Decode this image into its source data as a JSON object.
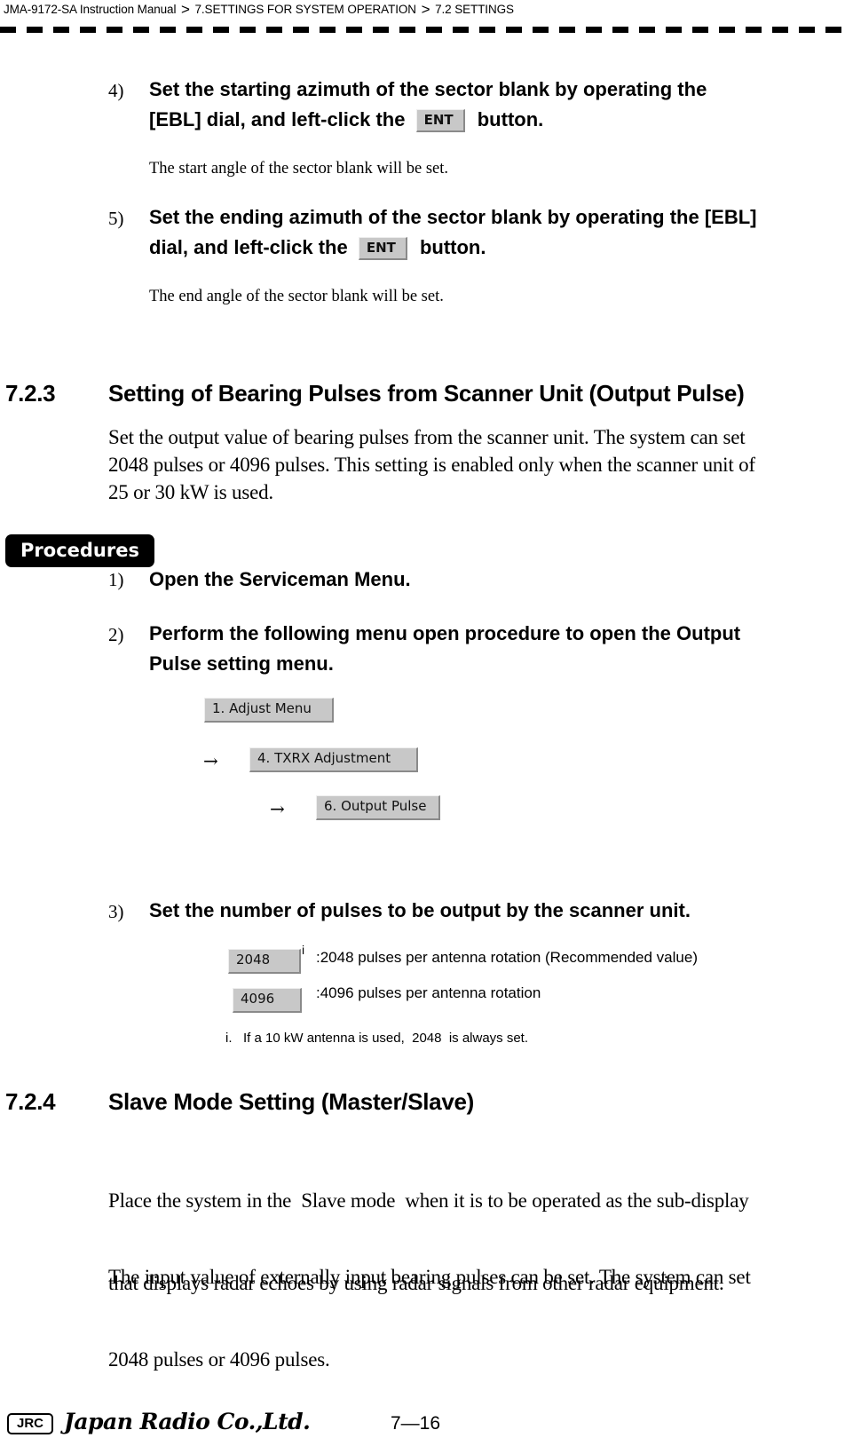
{
  "header": {
    "breadcrumb": [
      "JMA-9172-SA Instruction Manual",
      "7.SETTINGS FOR SYSTEM OPERATION",
      "7.2  SETTINGS"
    ],
    "separator": ">"
  },
  "section_722_tail": {
    "steps": [
      {
        "num": "4)",
        "line1": "Set the starting azimuth of the sector blank by operating the",
        "line2_pre": "[EBL] dial, and left-click the",
        "button": "ENT",
        "line2_post": "button.",
        "note": "The start angle of the sector blank will be set."
      },
      {
        "num": "5)",
        "line1": "Set the ending azimuth of the sector blank by operating the [EBL]",
        "line2_pre": "dial, and left-click the",
        "button": "ENT",
        "line2_post": "button.",
        "note": "The end angle of the sector blank will be set."
      }
    ]
  },
  "section_723": {
    "number": "7.2.3",
    "title": "Setting of Bearing Pulses from Scanner Unit (Output Pulse)",
    "body": [
      "Set the output value of bearing pulses from the scanner unit. The system can set",
      "2048 pulses or 4096 pulses. This setting is enabled only when the scanner unit of",
      "25 or 30 kW is used."
    ],
    "procedures_label": "Procedures",
    "steps": [
      {
        "num": "1)",
        "text": "Open the Serviceman Menu."
      },
      {
        "num": "2)",
        "line1": "Perform the following menu open procedure to open the Output",
        "line2": "Pulse setting menu."
      },
      {
        "num": "3)",
        "text": "Set the number of pulses to be output by the scanner unit."
      }
    ],
    "menu_path": {
      "arrow": "→",
      "items": [
        "1. Adjust Menu",
        "4. TXRX Adjustment",
        "6. Output Pulse"
      ]
    },
    "options": [
      {
        "button": "2048",
        "footnote_mark": "i",
        "description": ":2048 pulses per antenna rotation (Recommended value)"
      },
      {
        "button": "4096",
        "description": ":4096 pulses per antenna rotation"
      }
    ],
    "footnote": "i.   If a 10 kW antenna is used,  2048  is always set."
  },
  "section_724": {
    "number": "7.2.4",
    "title": "Slave Mode Setting (Master/Slave)",
    "para1": [
      "Place the system in the  Slave mode  when it is to be operated as the sub-display",
      "that displays radar echoes by using radar signals from other radar equipment."
    ],
    "para2": [
      "The input value of externally input bearing pulses can be set. The system can set",
      "2048 pulses or 4096 pulses."
    ]
  },
  "footer": {
    "logo": "JRC",
    "company": "Japan Radio Co.,Ltd.",
    "page_number": "7—16"
  }
}
